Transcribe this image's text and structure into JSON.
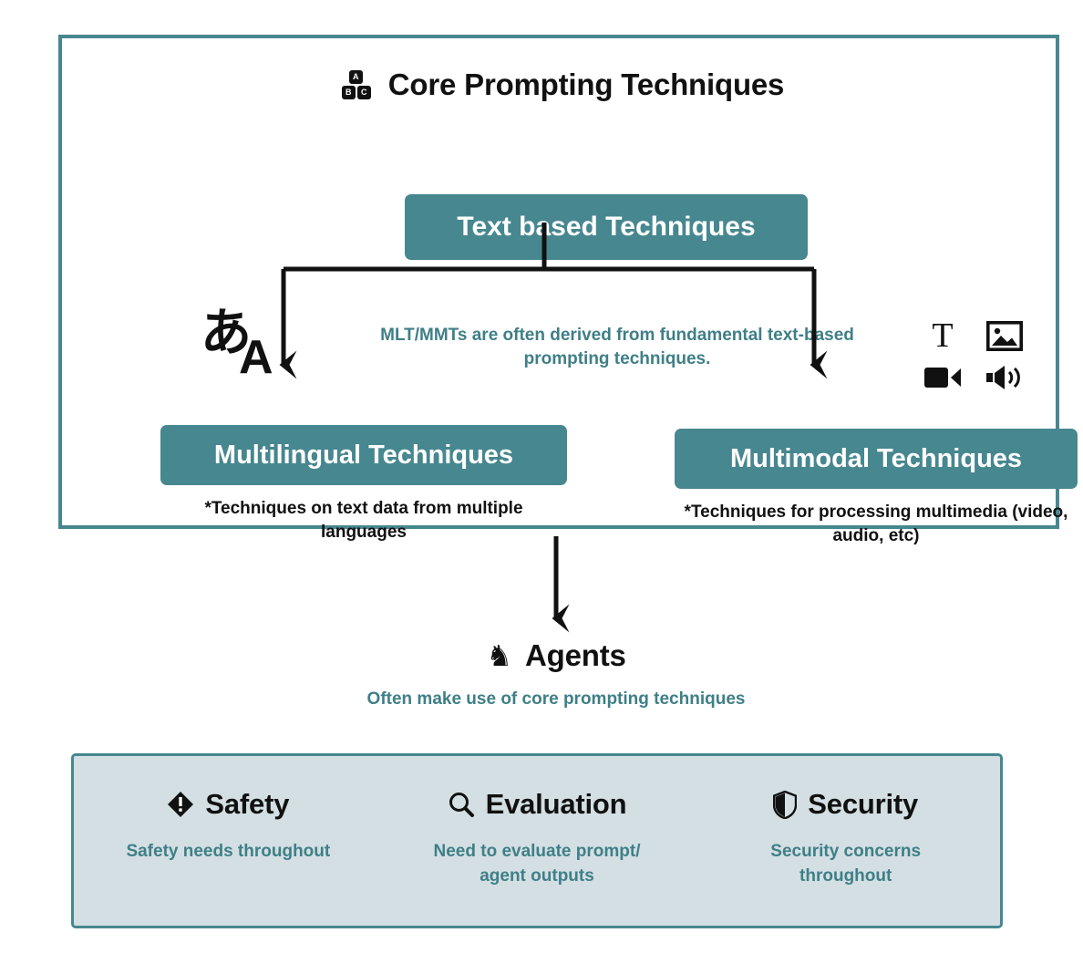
{
  "colors": {
    "teal": "#47878f",
    "teal_text": "#3f7f87",
    "panel_bg": "#d3dfe3",
    "ink": "#111111",
    "white": "#ffffff"
  },
  "core_panel": {
    "title": "Core Prompting Techniques",
    "title_icon": "abc-blocks-icon",
    "blocks": [
      "A",
      "B",
      "C"
    ],
    "text_box": {
      "label": "Text based Techniques"
    },
    "derived_note": "MLT/MMTs are often derived from fundamental text-based prompting techniques.",
    "language_icon": {
      "name": "language-icon",
      "japanese_glyph": "あ",
      "latin_glyph": "A"
    },
    "modality_icons": [
      {
        "name": "text-icon",
        "glyph": "T"
      },
      {
        "name": "image-icon",
        "glyph": "picture"
      },
      {
        "name": "video-icon",
        "glyph": "video-camera"
      },
      {
        "name": "audio-icon",
        "glyph": "speaker"
      }
    ],
    "branches": [
      {
        "id": "multilingual",
        "label": "Multilingual Techniques",
        "caption": "*Techniques on text data from multiple languages"
      },
      {
        "id": "multimodal",
        "label": "Multimodal Techniques",
        "caption": "*Techniques for processing multimedia (video, audio, etc)"
      }
    ]
  },
  "agents": {
    "icon": "chess-knight-icon",
    "glyph": "♞",
    "title": "Agents",
    "note": "Often make use of core prompting techniques"
  },
  "concerns": [
    {
      "id": "safety",
      "icon": "warning-diamond-icon",
      "label": "Safety",
      "desc": "Safety needs throughout"
    },
    {
      "id": "evaluation",
      "icon": "magnifier-icon",
      "label": "Evaluation",
      "desc": "Need to evaluate prompt/ agent outputs"
    },
    {
      "id": "security",
      "icon": "shield-icon",
      "label": "Security",
      "desc": "Security concerns throughout"
    }
  ]
}
